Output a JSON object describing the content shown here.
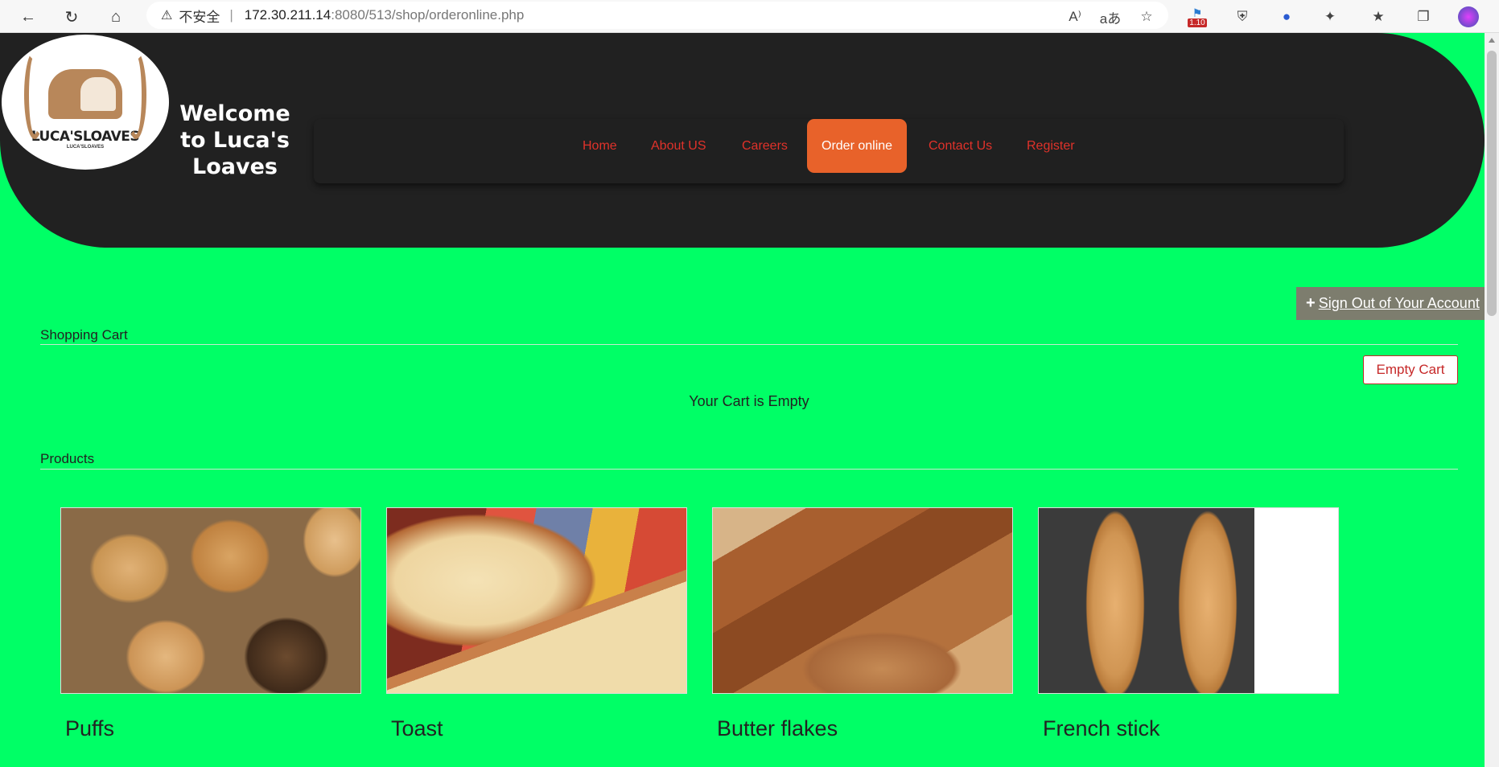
{
  "browser": {
    "security_warning": "不安全",
    "url_host": "172.30.211.14",
    "url_path": ":8080/513/shop/orderonline.php",
    "extension_badge": "1.10"
  },
  "header": {
    "logo_text": "LUCA'SLOAVES",
    "logo_subtext": "LUCA'SLOAVES",
    "welcome": "Welcome to Luca's Loaves",
    "nav": [
      {
        "label": "Home"
      },
      {
        "label": "About US"
      },
      {
        "label": "Careers"
      },
      {
        "label": "Order online"
      },
      {
        "label": "Contact Us"
      },
      {
        "label": "Register"
      }
    ]
  },
  "account": {
    "signout_label": "Sign Out of Your Account"
  },
  "cart": {
    "title": "Shopping Cart",
    "empty_button": "Empty Cart",
    "empty_message": "Your Cart is Empty"
  },
  "products": {
    "title": "Products",
    "items": [
      {
        "name": "Puffs"
      },
      {
        "name": "Toast"
      },
      {
        "name": "Butter flakes"
      },
      {
        "name": "French stick"
      }
    ]
  },
  "colors": {
    "page_bg": "#00ff66",
    "header_bg": "#212121",
    "nav_link": "#e0322a",
    "nav_active_bg": "#e8622a",
    "signout_bg": "#7d7d6e",
    "empty_cart_border": "#c62828"
  }
}
